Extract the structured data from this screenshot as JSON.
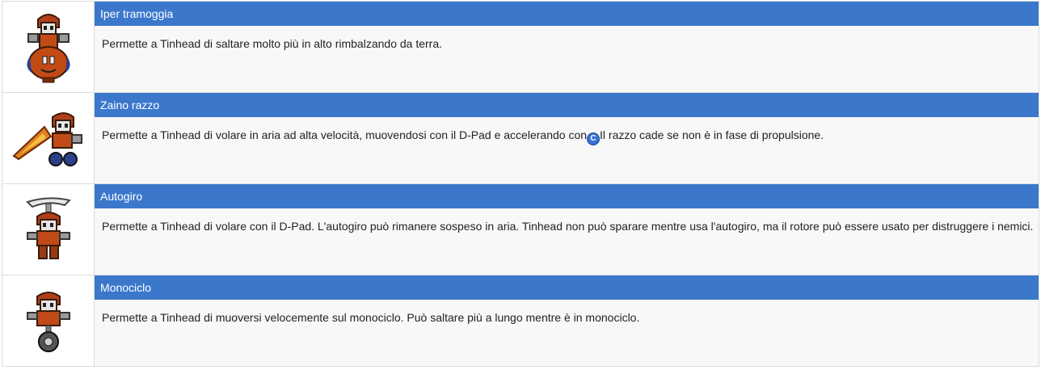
{
  "powerups": [
    {
      "title": "Iper tramoggia",
      "description": "Permette a Tinhead di saltare molto più in alto rimbalzando da terra.",
      "icon": "tinhead-hopper-sprite"
    },
    {
      "title": "Zaino razzo",
      "description_before": "Permette a Tinhead di volare in aria ad alta velocità, muovendosi con il D-Pad e accelerando con",
      "button_label": "C",
      "description_after": "Il razzo cade se non è in fase di propulsione.",
      "icon": "tinhead-rocket-pack-sprite"
    },
    {
      "title": "Autogiro",
      "description": "Permette a Tinhead di volare con il D-Pad. L'autogiro può rimanere sospeso in aria. Tinhead non può sparare mentre usa l'autogiro, ma il rotore può essere usato per distruggere i nemici.",
      "icon": "tinhead-gyrocopter-sprite"
    },
    {
      "title": "Monociclo",
      "description": "Permette a Tinhead di muoversi velocemente sul monociclo. Può saltare più a lungo mentre è in monociclo.",
      "icon": "tinhead-unicycle-sprite"
    }
  ],
  "colors": {
    "header_bg": "#3b78cc",
    "header_text": "#ffffff",
    "body_bg": "#f8f8f8",
    "border": "#dcdcdc",
    "button_bg": "#3a6fd8"
  }
}
